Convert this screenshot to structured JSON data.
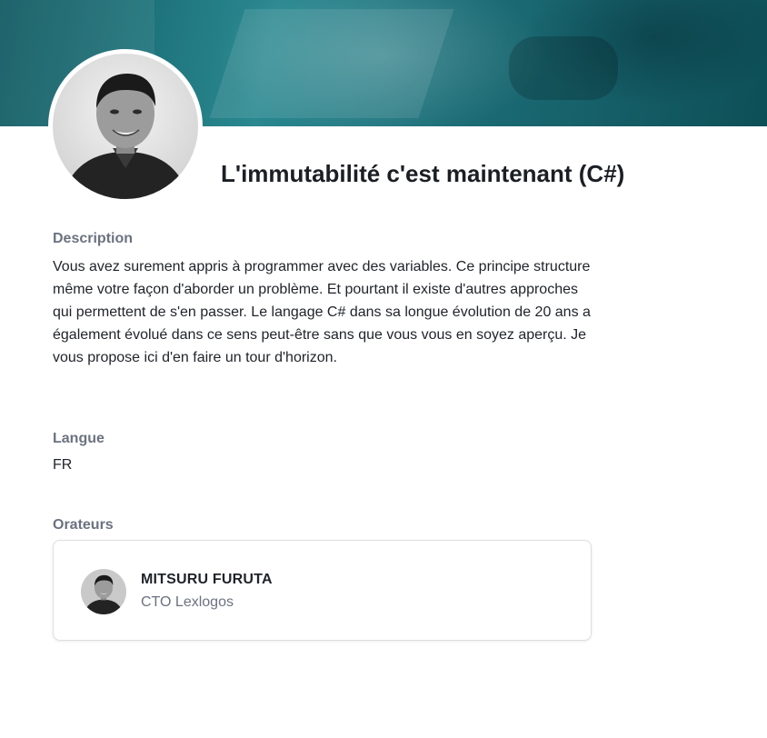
{
  "talk": {
    "title": "L'immutabilité c'est maintenant (C#)"
  },
  "description": {
    "label": "Description",
    "text": "Vous avez surement appris à programmer avec des variables. Ce principe structure même votre façon d'aborder un problème. Et pourtant il existe d'autres approches qui permettent de s'en passer. Le langage C# dans sa longue évolution de 20 ans a également évolué dans ce sens peut-être sans que vous vous en soyez aperçu. Je vous propose ici d'en faire un tour d'horizon."
  },
  "language": {
    "label": "Langue",
    "value": "FR"
  },
  "speakers": {
    "label": "Orateurs",
    "items": [
      {
        "name": "MITSURU FURUTA",
        "role": "CTO Lexlogos"
      }
    ]
  },
  "colors": {
    "banner": "#1c6d77",
    "label_gray": "#6b7280",
    "text_dark": "#1f2328"
  },
  "icons": [
    "speaker-photo",
    "banner-image"
  ]
}
